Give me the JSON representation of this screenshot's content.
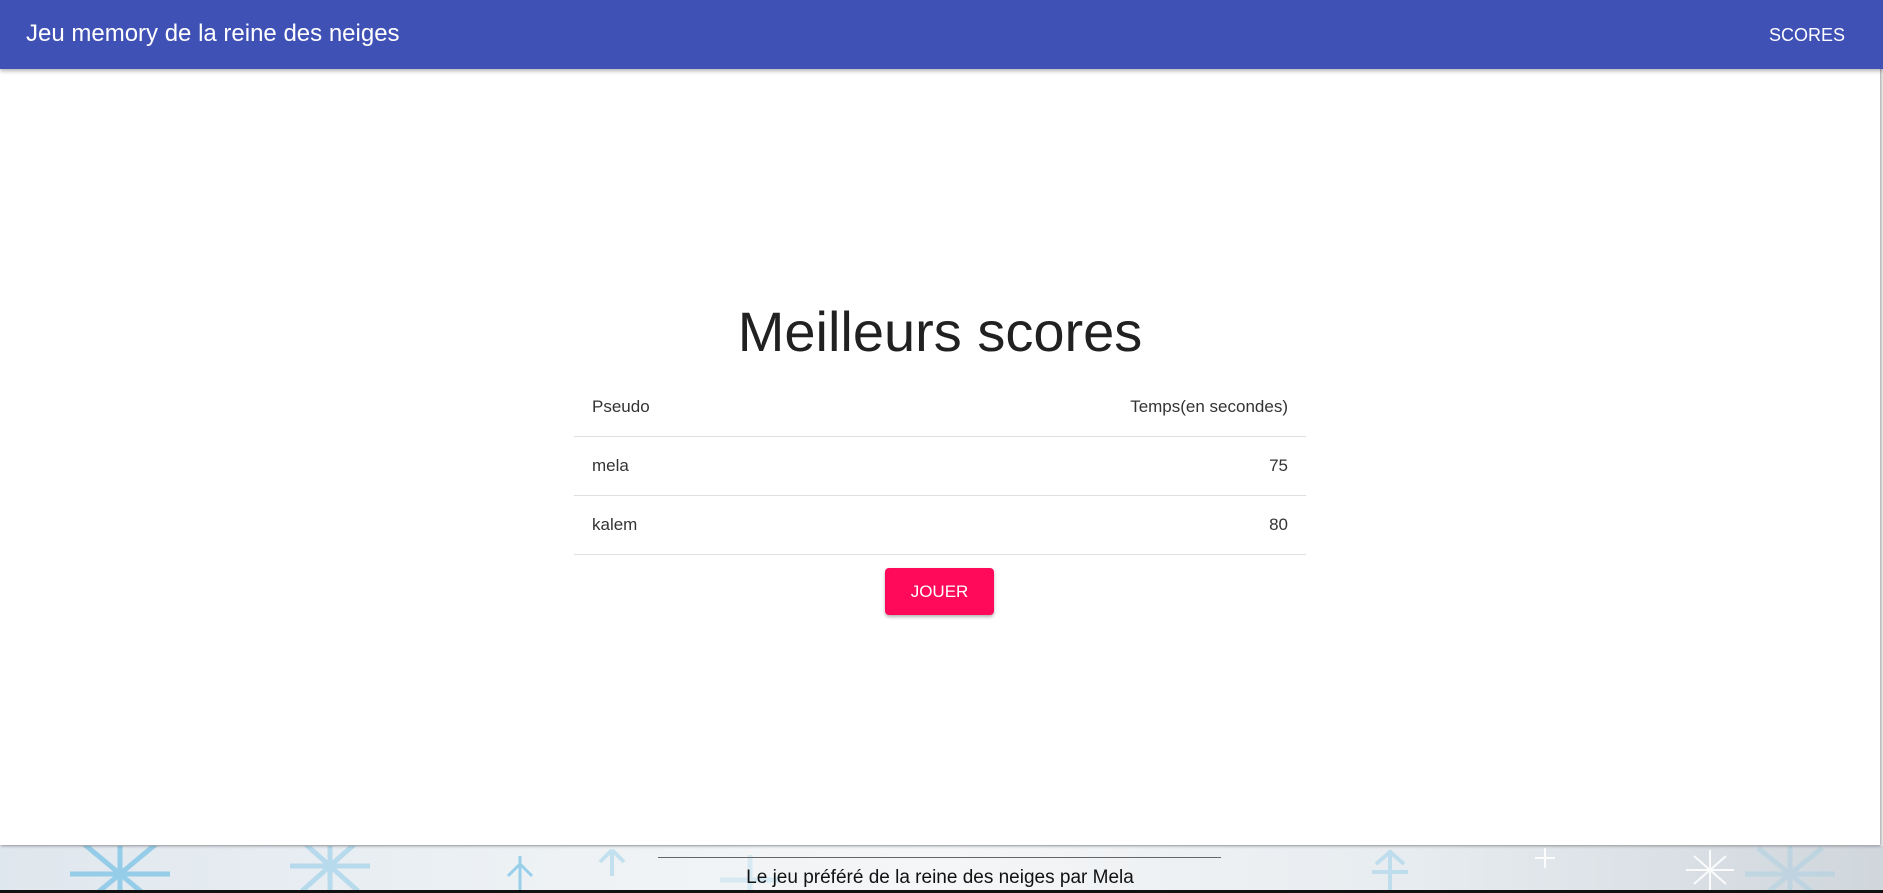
{
  "toolbar": {
    "title": "Jeu memory de la reine des neiges",
    "scores_link": "SCORES",
    "color": "#3f51b5"
  },
  "main": {
    "heading": "Meilleurs scores",
    "table": {
      "headers": [
        "Pseudo",
        "Temps(en secondes)"
      ],
      "rows": [
        {
          "pseudo": "mela",
          "temps": "75"
        },
        {
          "pseudo": "kalem",
          "temps": "80"
        }
      ]
    },
    "play_button": "JOUER",
    "accent_color": "#ff0a5a"
  },
  "footer": {
    "text": "Le jeu préféré de la reine des neiges par Mela",
    "background_icon": "snowflake-pattern"
  }
}
